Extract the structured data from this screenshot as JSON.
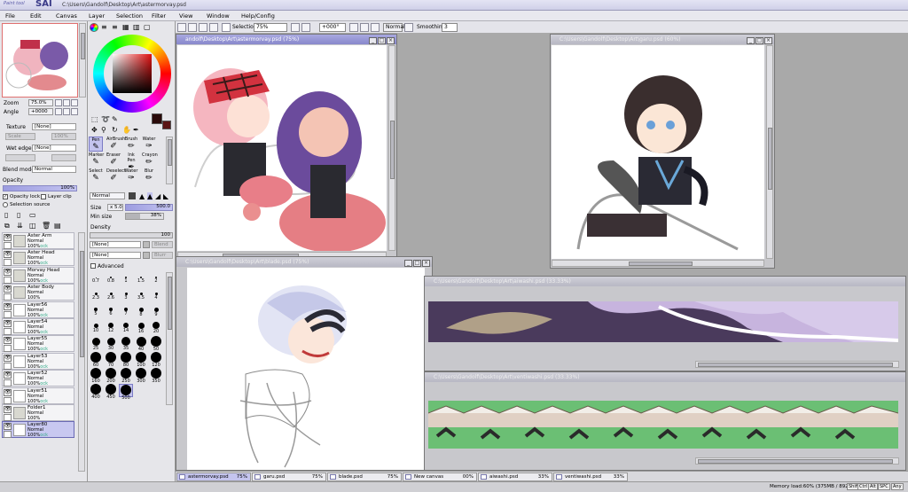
{
  "app": {
    "logo": "SAI",
    "logo_sub": "Paint tool",
    "path": "C:\\Users\\Gandolf\\Desktop\\Art\\astermorvay.psd"
  },
  "menu": [
    "File",
    "Edit",
    "Canvas",
    "Layer",
    "Selection",
    "Filter",
    "View",
    "Window",
    "Help/Config"
  ],
  "toolbar": {
    "selection_label": "Selection",
    "zoom": "75%",
    "angle": "+000°",
    "mode": "Normal",
    "smoothing_label": "Smoothing",
    "smoothing": "3"
  },
  "nav": {
    "zoom_label": "Zoom",
    "zoom": "75.0%",
    "angle_label": "Angle",
    "angle": "+0000"
  },
  "texture": {
    "texture_label": "Texture",
    "texture": "[None]",
    "scale_label": "Scale",
    "scale": "100%",
    "wet_edge_label": "Wet edge",
    "wet_edge": "[None]",
    "blend_label": "Blend mode",
    "blend": "Normal",
    "opacity_label": "Opacity",
    "opacity": "100%",
    "opacity_lock": "Opacity lock",
    "layer_clip": "Layer clip",
    "selection_source": "Selection source"
  },
  "layers": [
    {
      "name": "Aster Arm",
      "mode": "Normal",
      "opacity": "100%",
      "lock": "ock",
      "folder": true
    },
    {
      "name": "Aster Head",
      "mode": "Normal",
      "opacity": "100%",
      "lock": "ock",
      "folder": true
    },
    {
      "name": "Morvay Head",
      "mode": "Normal",
      "opacity": "100%",
      "lock": "ock",
      "folder": true
    },
    {
      "name": "Aster Body",
      "mode": "Normal",
      "opacity": "100%",
      "lock": "",
      "folder": true
    },
    {
      "name": "Layer56",
      "mode": "Normal",
      "opacity": "100%",
      "lock": "ock",
      "folder": false
    },
    {
      "name": "Layer54",
      "mode": "Normal",
      "opacity": "100%",
      "lock": "ock",
      "folder": false
    },
    {
      "name": "Layer55",
      "mode": "Normal",
      "opacity": "100%",
      "lock": "ock",
      "folder": false
    },
    {
      "name": "Layer53",
      "mode": "Normal",
      "opacity": "100%",
      "lock": "ock",
      "folder": false
    },
    {
      "name": "Layer52",
      "mode": "Normal",
      "opacity": "100%",
      "lock": "ock",
      "folder": false
    },
    {
      "name": "Layer51",
      "mode": "Normal",
      "opacity": "100%",
      "lock": "ock",
      "folder": false
    },
    {
      "name": "Folder1",
      "mode": "Normal",
      "opacity": "100%",
      "lock": "",
      "folder": true
    },
    {
      "name": "Layer80",
      "mode": "Normal",
      "opacity": "100%",
      "lock": "ock",
      "folder": false,
      "selected": true
    }
  ],
  "tools": {
    "row1": [
      "Pen",
      "AirBrush",
      "Brush",
      "Water"
    ],
    "row2": [
      "Marker",
      "Eraser",
      "Ink Pen",
      "Crayon"
    ],
    "row3": [
      "Select",
      "Deselect",
      "Water",
      "Blur"
    ],
    "mode": "Normal",
    "size_label": "Size",
    "size_mult": "x 5.0",
    "size": "500.0",
    "min_size_label": "Min size",
    "min_size": "38%",
    "density_label": "Density",
    "density": "100",
    "shape": "[None]",
    "shape_pct": "Blend",
    "shape2": "[None]",
    "shape2_pct": "Blurr",
    "advanced": "Advanced"
  },
  "brush_sizes": [
    "0.7",
    "0.8",
    "1",
    "1.5",
    "2",
    "2.3",
    "2.6",
    "3",
    "3.5",
    "4",
    "5",
    "6",
    "7",
    "8",
    "9",
    "10",
    "12",
    "14",
    "16",
    "20",
    "25",
    "30",
    "35",
    "40",
    "50",
    "60",
    "70",
    "80",
    "100",
    "120",
    "160",
    "200",
    "250",
    "300",
    "350",
    "400",
    "450",
    "500"
  ],
  "windows": {
    "main_title": "andolf\\Desktop\\Art\\astermorvay.psd (75%)",
    "garu_title": "C:\\Users\\Gandolf\\Desktop\\Art\\garu.psd (60%)",
    "blade_title": "C:\\Users\\Gandolf\\Desktop\\Art\\blade.psd (75%)",
    "aiwashi_title": "C:\\Users\\Gandolf\\Desktop\\Art\\aiwashi.psd (33.33%)",
    "ventiwashi_title": "C:\\Users\\Gandolf\\Desktop\\Art\\ventiwashi.psd (33.33%)"
  },
  "tasks": [
    {
      "name": "astermorvay.psd",
      "pct": "75%"
    },
    {
      "name": "garu.psd",
      "pct": "75%"
    },
    {
      "name": "blade.psd",
      "pct": "75%"
    },
    {
      "name": "New canvas",
      "pct": "00%"
    },
    {
      "name": "aiwashi.psd",
      "pct": "33%"
    },
    {
      "name": "ventiwashi.psd",
      "pct": "33%"
    }
  ],
  "status": {
    "memory": "Memory load:60% (375MB / 892MB)",
    "keys": [
      "Shift",
      "Ctrl",
      "Alt",
      "SPC",
      "Any"
    ]
  },
  "colors": {
    "accent": "#8888cc",
    "pink": "#e79aa8",
    "purple": "#6f4aa2",
    "green": "#79c97f"
  }
}
